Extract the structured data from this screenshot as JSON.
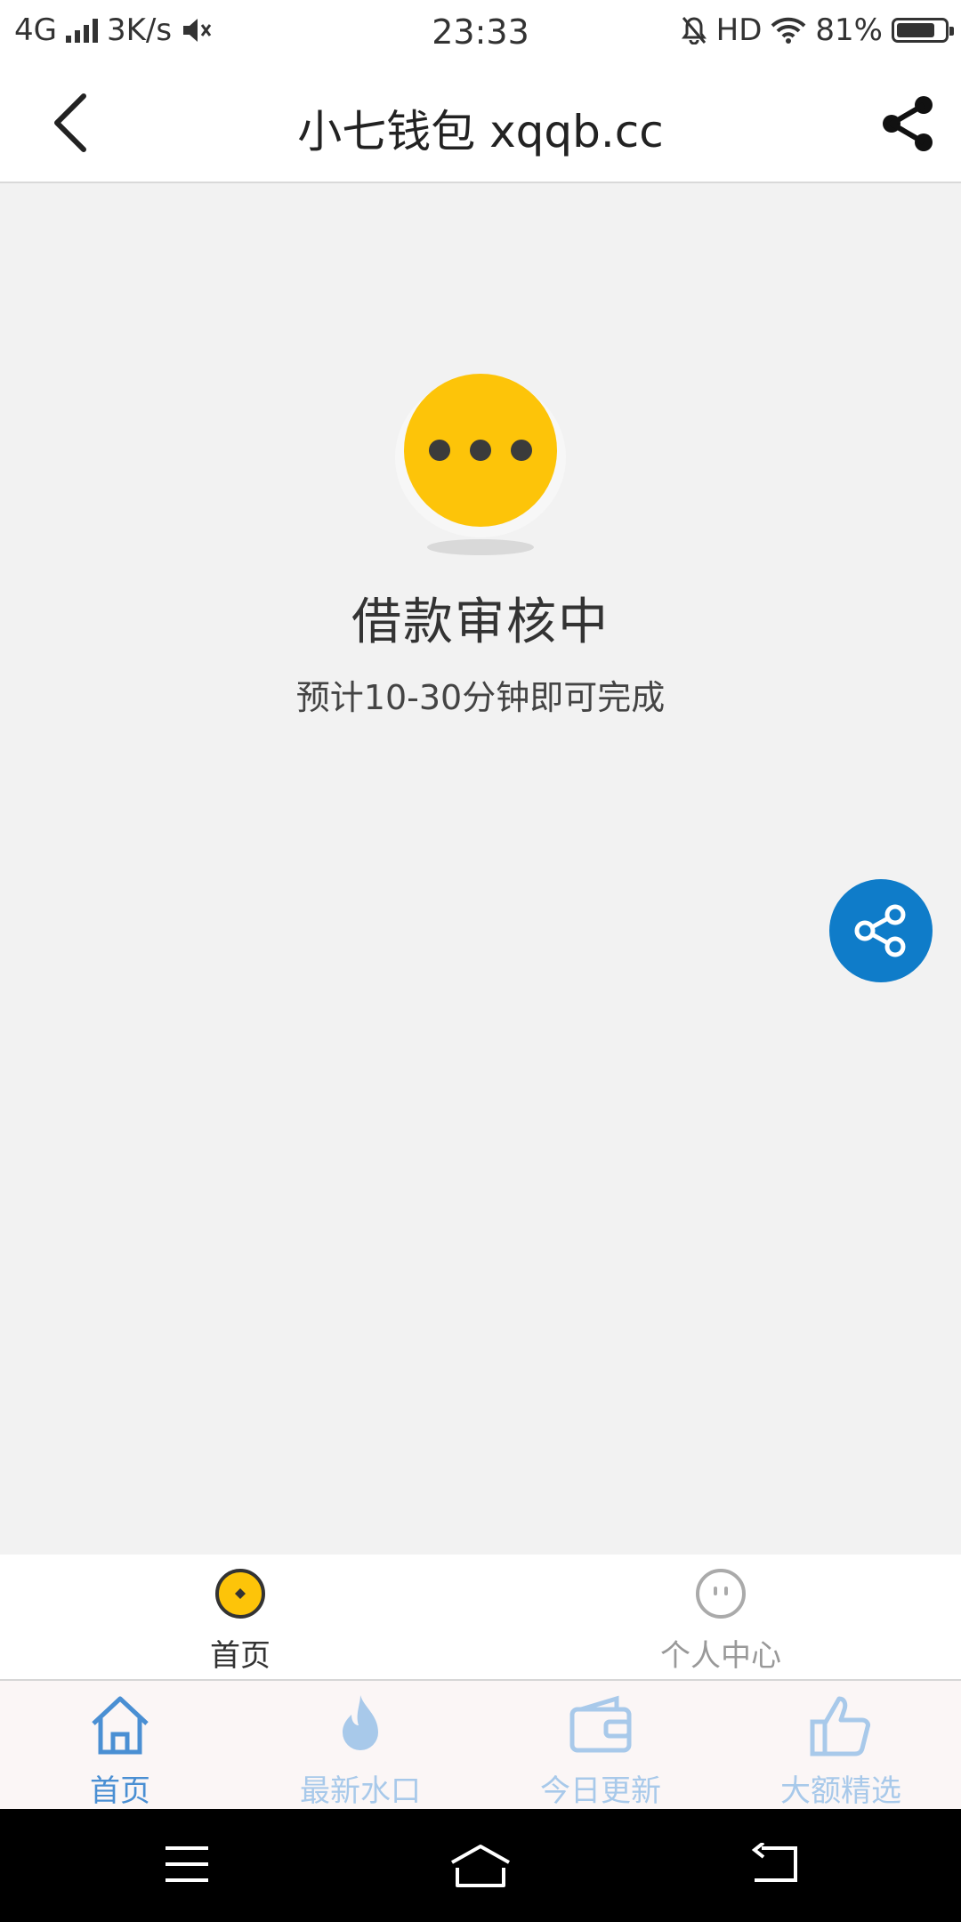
{
  "status_bar": {
    "network": "4G",
    "speed": "3K/s",
    "time": "23:33",
    "hd": "HD",
    "battery_percent": "81%",
    "battery_level": 0.81
  },
  "header": {
    "title": "小七钱包 xqqb.cc"
  },
  "loan_status": {
    "title": "借款审核中",
    "subtitle": "预计10-30分钟即可完成"
  },
  "inner_tabs": [
    {
      "label": "首页",
      "active": true
    },
    {
      "label": "个人中心",
      "active": false
    }
  ],
  "bottom_nav": [
    {
      "label": "首页",
      "active": true
    },
    {
      "label": "最新水口",
      "active": false
    },
    {
      "label": "今日更新",
      "active": false
    },
    {
      "label": "大额精选",
      "active": false
    }
  ],
  "colors": {
    "accent_yellow": "#fdc409",
    "fab_blue": "#0f7cc9",
    "nav_blue": "#4a8fd3",
    "nav_blue_dim": "#a8c9ea"
  }
}
